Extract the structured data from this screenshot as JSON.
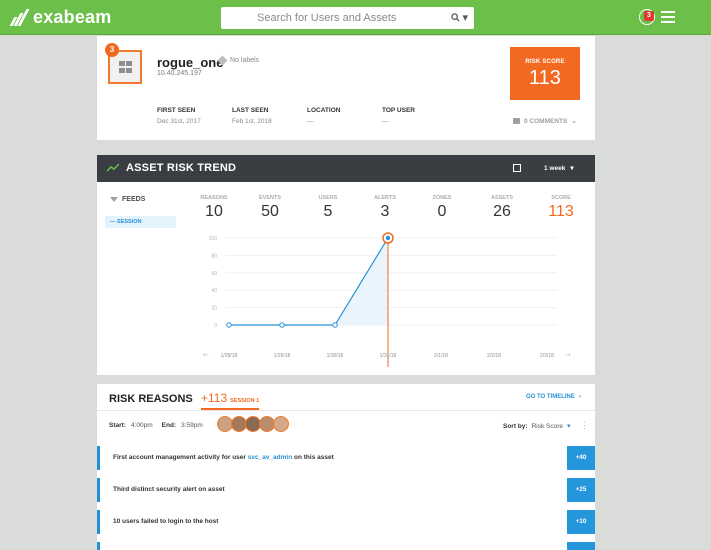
{
  "app": {
    "brand": "exabeam"
  },
  "search": {
    "placeholder": "Search for Users and Assets"
  },
  "header": {
    "notification_count": "3"
  },
  "asset": {
    "badge": "3",
    "name": "rogue_one",
    "ip": "10.40.245.197",
    "labels": "No labels",
    "risk_label": "RISK SCORE",
    "risk_score": "113",
    "meta": [
      {
        "label": "FIRST SEEN",
        "value": "Dec 31st, 2017"
      },
      {
        "label": "LAST SEEN",
        "value": "Feb 1st, 2018"
      },
      {
        "label": "LOCATION",
        "value": "—"
      },
      {
        "label": "TOP USER",
        "value": "—"
      }
    ],
    "comments": "0 COMMENTS"
  },
  "trend": {
    "title": "ASSET RISK TREND",
    "range": "1 week",
    "feeds_label": "FEEDS",
    "session_label": "SESSION",
    "stats": [
      {
        "label": "REASONS",
        "value": "10"
      },
      {
        "label": "EVENTS",
        "value": "50"
      },
      {
        "label": "USERS",
        "value": "5"
      },
      {
        "label": "ALERTS",
        "value": "3"
      },
      {
        "label": "ZONES",
        "value": "0"
      },
      {
        "label": "ASSETS",
        "value": "26"
      },
      {
        "label": "SCORE",
        "value": "113"
      }
    ]
  },
  "chart_data": {
    "type": "area",
    "x": [
      "1/28/18",
      "1/29/18",
      "1/30/18",
      "1/31/18",
      "2/1/18",
      "2/2/18",
      "2/3/18"
    ],
    "series": [
      {
        "values": [
          0,
          0,
          0,
          100,
          null,
          null,
          null
        ]
      }
    ],
    "y_ticks": [
      0,
      20,
      40,
      60,
      80,
      100
    ],
    "ylim": [
      0,
      100
    ],
    "highlight_index": 3,
    "colors": {
      "line": "#2891d6",
      "fill": "#e3f1fb",
      "marker": "#f26a21"
    }
  },
  "reasons": {
    "title": "RISK REASONS",
    "score": "+113",
    "session": "SESSION 1",
    "timeline_link": "GO TO TIMELINE",
    "start_label": "Start:",
    "start_value": "4:00pm",
    "end_label": "End:",
    "end_value": "3:59pm",
    "sort_label": "Sort by:",
    "sort_value": "Risk Score",
    "avatars": [
      "#c9a27e",
      "#a6795a",
      "#8b6a52",
      "#b98d6b",
      "#d4a98a"
    ],
    "items": [
      {
        "text": "First account management activity for user",
        "link": "svc_av_admin",
        "suffix": "on this asset",
        "score": "+40"
      },
      {
        "text": "Third distinct security alert on asset",
        "score": "+25"
      },
      {
        "text": "10 users failed to login to the host",
        "score": "+10"
      }
    ]
  }
}
